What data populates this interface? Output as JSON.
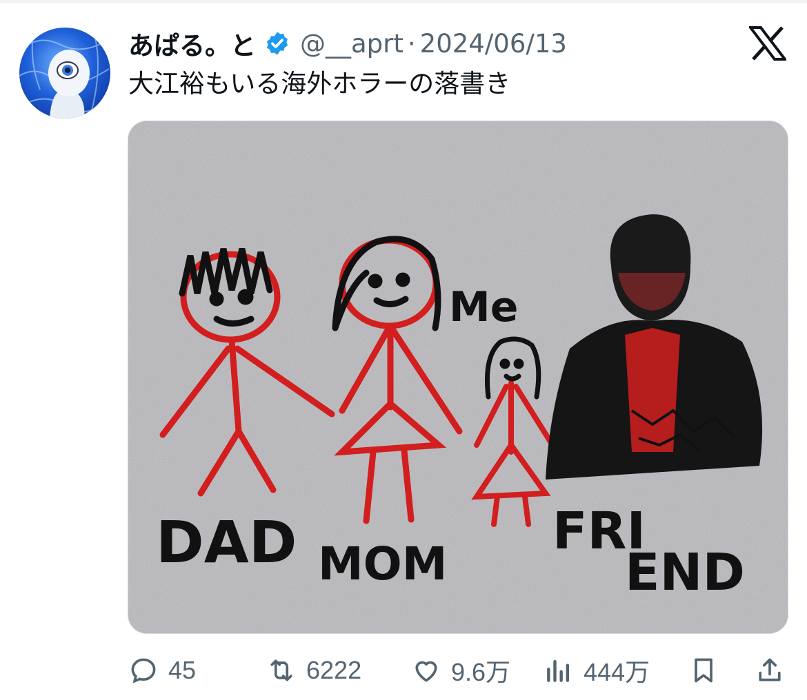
{
  "author": {
    "name": "あぱる。と",
    "handle": "@__aprt",
    "separator": "·",
    "date": "2024/06/13",
    "verified": true,
    "avatar_icon": "eye-creature-avatar"
  },
  "platform_icon": "x-logo-icon",
  "tweet": {
    "text": "大江裕もいる海外ホラーの落書き"
  },
  "media": {
    "image_icon": "crayon-drawing-image",
    "drawing_labels": {
      "dad": "DAD",
      "mom": "MOM",
      "me": "Me",
      "friend_line1": "FRI",
      "friend_line2": "END"
    }
  },
  "actions": {
    "replies": "45",
    "retweets": "6222",
    "likes": "9.6万",
    "views": "444万"
  },
  "colors": {
    "text_primary": "#0f1419",
    "text_secondary": "#536471",
    "verified_blue": "#1d9bf0",
    "crayon_red": "#d21e1e",
    "crayon_black": "#111111"
  }
}
